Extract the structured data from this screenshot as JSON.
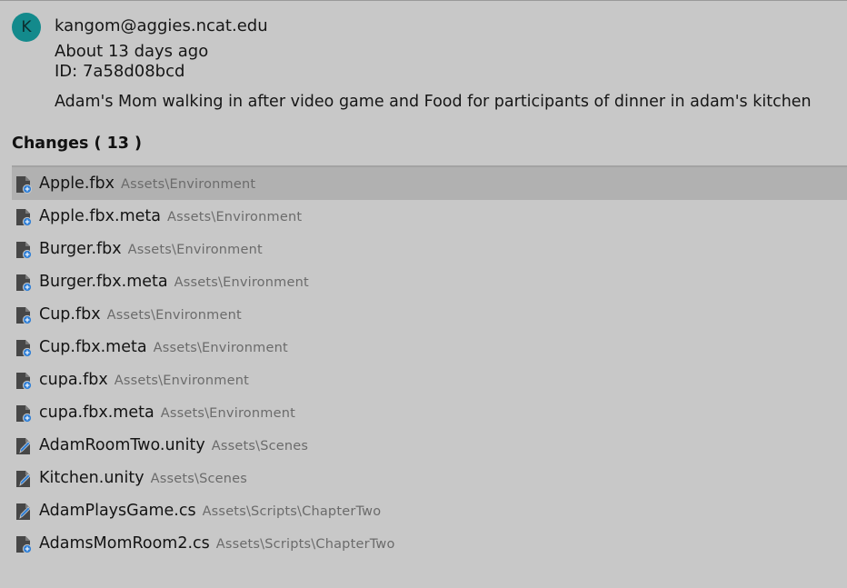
{
  "commit": {
    "avatar_letter": "K",
    "author": "kangom@aggies.ncat.edu",
    "time": "About 13 days ago",
    "id": "ID: 7a58d08bcd",
    "message": "Adam's Mom walking in after video game and Food for participants of dinner in adam's kitchen"
  },
  "changes": {
    "header": "Changes ( 13 )",
    "items": [
      {
        "name": "Apple.fbx",
        "path": "Assets\\Environment",
        "icon": "file-added-icon"
      },
      {
        "name": "Apple.fbx.meta",
        "path": "Assets\\Environment",
        "icon": "file-added-icon"
      },
      {
        "name": "Burger.fbx",
        "path": "Assets\\Environment",
        "icon": "file-added-icon"
      },
      {
        "name": "Burger.fbx.meta",
        "path": "Assets\\Environment",
        "icon": "file-added-icon"
      },
      {
        "name": "Cup.fbx",
        "path": "Assets\\Environment",
        "icon": "file-added-icon"
      },
      {
        "name": "Cup.fbx.meta",
        "path": "Assets\\Environment",
        "icon": "file-added-icon"
      },
      {
        "name": "cupa.fbx",
        "path": "Assets\\Environment",
        "icon": "file-added-icon"
      },
      {
        "name": "cupa.fbx.meta",
        "path": "Assets\\Environment",
        "icon": "file-added-icon"
      },
      {
        "name": "AdamRoomTwo.unity",
        "path": "Assets\\Scenes",
        "icon": "file-modified-icon"
      },
      {
        "name": "Kitchen.unity",
        "path": "Assets\\Scenes",
        "icon": "file-modified-icon"
      },
      {
        "name": "AdamPlaysGame.cs",
        "path": "Assets\\Scripts\\ChapterTwo",
        "icon": "file-modified-icon"
      },
      {
        "name": "AdamsMomRoom2.cs",
        "path": "Assets\\Scripts\\ChapterTwo",
        "icon": "file-added-icon"
      }
    ]
  },
  "colors": {
    "background": "#c8c8c8",
    "selected_row": "#b1b1b1",
    "avatar": "#138a8c",
    "badge": "#2f7fd6"
  }
}
